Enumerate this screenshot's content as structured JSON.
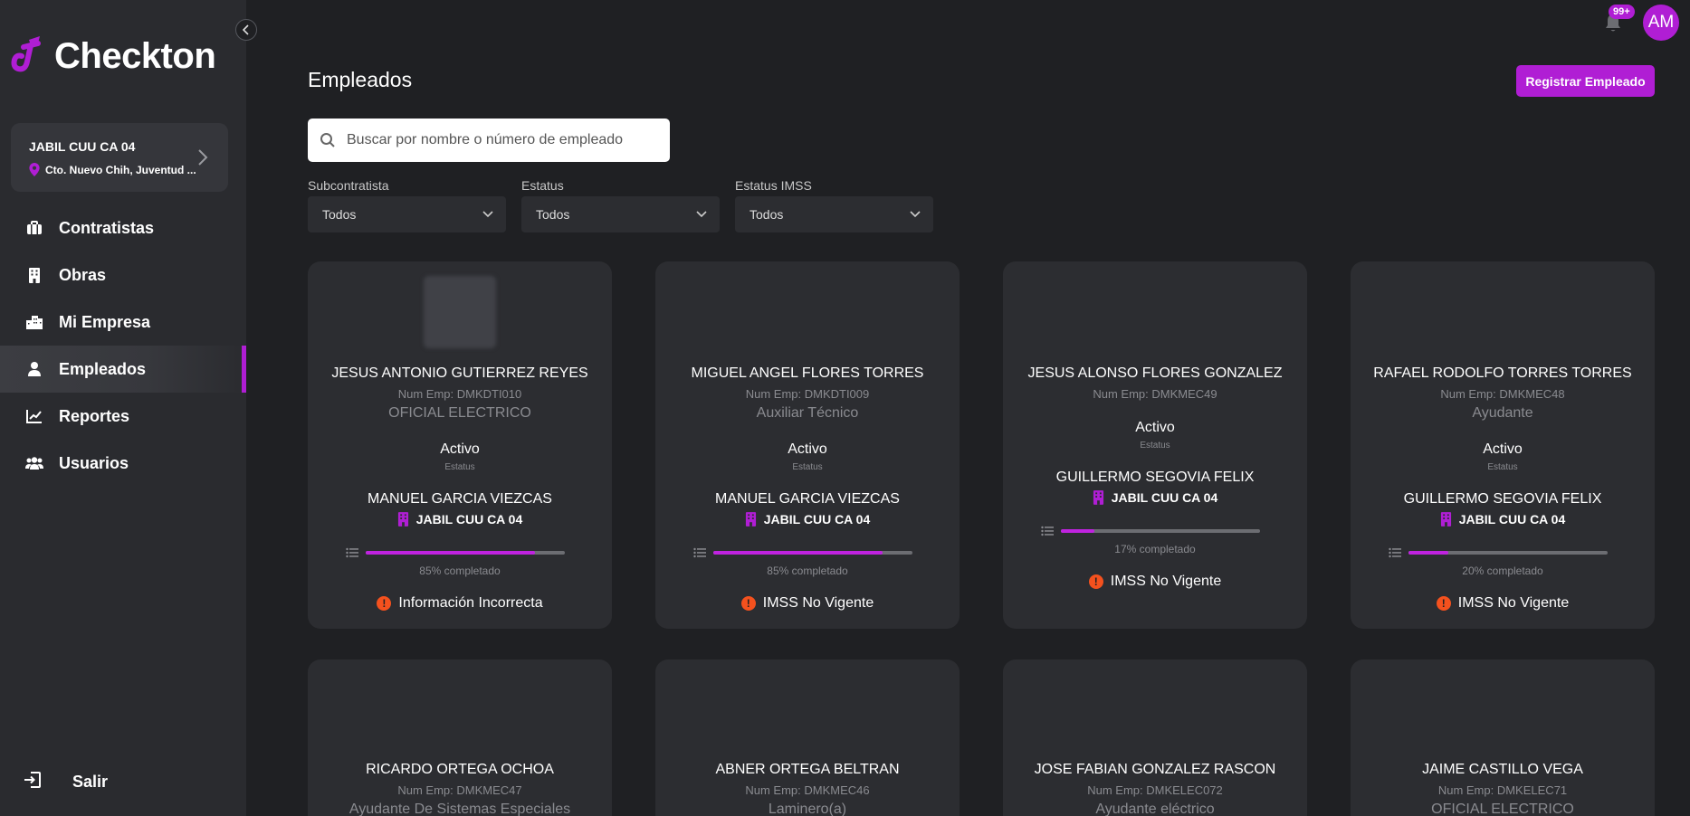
{
  "app": {
    "name": "Checkton"
  },
  "site": {
    "name": "JABIL CUU CA 04",
    "address": "Cto. Nuevo Chih, Juventud ..."
  },
  "nav": [
    {
      "label": "Contratistas",
      "icon": "briefcase-icon"
    },
    {
      "label": "Obras",
      "icon": "building-icon"
    },
    {
      "label": "Mi Empresa",
      "icon": "city-icon"
    },
    {
      "label": "Empleados",
      "icon": "person-icon",
      "active": true
    },
    {
      "label": "Reportes",
      "icon": "chart-line-icon"
    },
    {
      "label": "Usuarios",
      "icon": "users-icon"
    }
  ],
  "logout": {
    "label": "Salir"
  },
  "header": {
    "notifications_badge": "99+",
    "avatar_initials": "AM"
  },
  "page": {
    "title": "Empleados",
    "register_button": "Registrar Empleado"
  },
  "search": {
    "placeholder": "Buscar por nombre o número de empleado",
    "value": ""
  },
  "filters": [
    {
      "label": "Subcontratista",
      "value": "Todos"
    },
    {
      "label": "Estatus",
      "value": "Todos"
    },
    {
      "label": "Estatus IMSS",
      "value": "Todos"
    }
  ],
  "colors": {
    "accent": "#b01ed4",
    "alert": "#f4511e",
    "card_bg": "#2c2d31",
    "sidebar_bg": "#2a2b2f",
    "page_bg": "#1f2023"
  },
  "employees": [
    {
      "name": "JESUS ANTONIO GUTIERREZ REYES",
      "num": "Num Emp: DMKDTI010",
      "role": "OFICIAL ELECTRICO",
      "status": "Activo",
      "status_label": "Estatus",
      "supervisor": "MANUEL GARCIA VIEZCAS",
      "site": "JABIL CUU CA 04",
      "progress": 85,
      "progress_label": "85% completado",
      "alert": "Información Incorrecta"
    },
    {
      "name": "MIGUEL ANGEL FLORES TORRES",
      "num": "Num Emp: DMKDTI009",
      "role": "Auxiliar Técnico",
      "status": "Activo",
      "status_label": "Estatus",
      "supervisor": "MANUEL GARCIA VIEZCAS",
      "site": "JABIL CUU CA 04",
      "progress": 85,
      "progress_label": "85% completado",
      "alert": "IMSS No Vigente"
    },
    {
      "name": "JESUS ALONSO FLORES GONZALEZ",
      "num": "Num Emp: DMKMEC49",
      "role": "",
      "status": "Activo",
      "status_label": "Estatus",
      "supervisor": "GUILLERMO SEGOVIA FELIX",
      "site": "JABIL CUU CA 04",
      "progress": 17,
      "progress_label": "17% completado",
      "alert": "IMSS No Vigente"
    },
    {
      "name": "RAFAEL RODOLFO TORRES TORRES",
      "num": "Num Emp: DMKMEC48",
      "role": "Ayudante",
      "status": "Activo",
      "status_label": "Estatus",
      "supervisor": "GUILLERMO SEGOVIA FELIX",
      "site": "JABIL CUU CA 04",
      "progress": 20,
      "progress_label": "20% completado",
      "alert": "IMSS No Vigente"
    },
    {
      "name": "RICARDO ORTEGA OCHOA",
      "num": "Num Emp: DMKMEC47",
      "role": "Ayudante De Sistemas Especiales"
    },
    {
      "name": "ABNER ORTEGA BELTRAN",
      "num": "Num Emp: DMKMEC46",
      "role": "Laminero(a)"
    },
    {
      "name": "JOSE FABIAN GONZALEZ RASCON",
      "num": "Num Emp: DMKELEC072",
      "role": "Ayudante eléctrico"
    },
    {
      "name": "JAIME CASTILLO VEGA",
      "num": "Num Emp: DMKELEC71",
      "role": "OFICIAL ELECTRICO"
    }
  ]
}
